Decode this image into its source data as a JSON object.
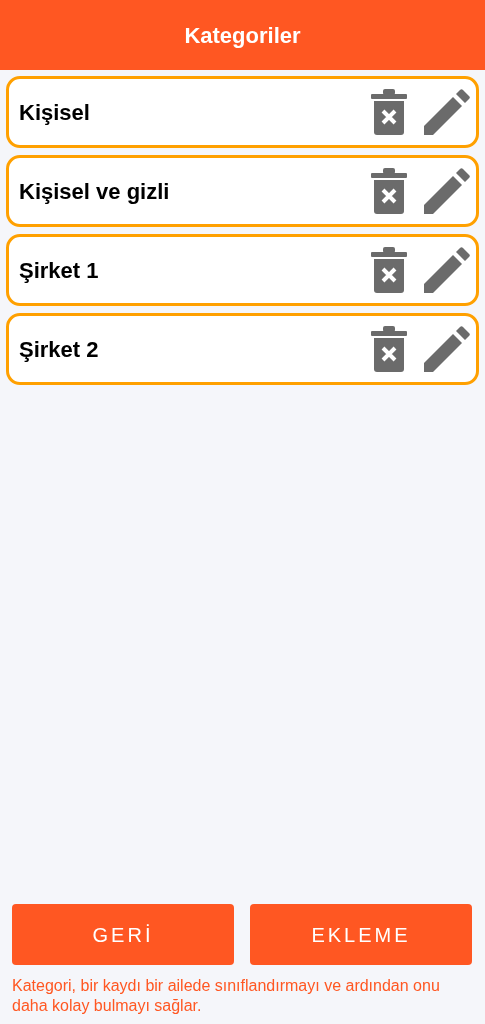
{
  "header": {
    "title": "Kategoriler"
  },
  "categories": [
    {
      "name": "Kişisel"
    },
    {
      "name": "Kişisel ve gizli"
    },
    {
      "name": "Şirket 1"
    },
    {
      "name": "Şirket 2"
    }
  ],
  "buttons": [
    {
      "label": "GERİ"
    },
    {
      "label": "EKLEME"
    }
  ],
  "help_text": "Kategori, bir kaydı bir ailede sınıflandırmayı ve ardından onu daha kolay bulmayı sağlar."
}
